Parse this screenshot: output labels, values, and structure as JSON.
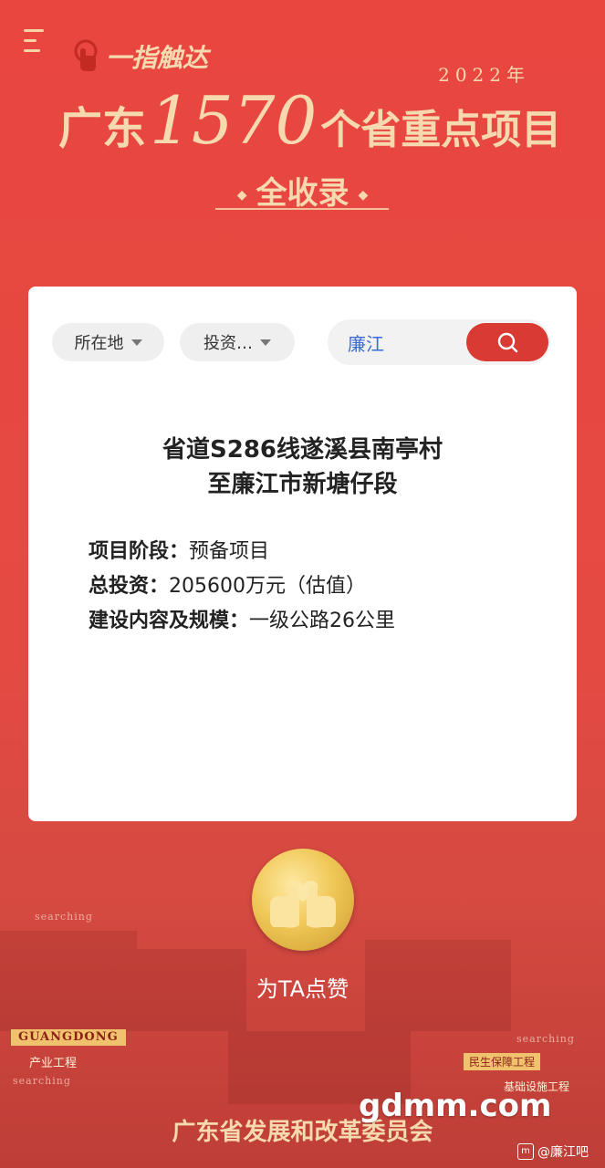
{
  "header": {
    "brand": "一指触达",
    "year": "2022年",
    "title_pre": "广东",
    "title_number": "1570",
    "title_post": "个省重点项目",
    "subtitle": "全收录"
  },
  "filters": {
    "location_label": "所在地",
    "investment_label": "投资…"
  },
  "search": {
    "value": "廉江"
  },
  "project": {
    "title_line1": "省道S286线遂溪县南亭村",
    "title_line2": "至廉江市新塘仔段",
    "stage_label": "项目阶段：",
    "stage_value": "预备项目",
    "investment_label": "总投资：",
    "investment_value": "205600万元（估值）",
    "scope_label": "建设内容及规模：",
    "scope_value": "一级公路26公里"
  },
  "like": {
    "label": "为TA点赞"
  },
  "background": {
    "searching_1": "searching",
    "searching_2": "searching",
    "searching_3": "searching",
    "guangdong": "GUANGDONG",
    "industry": "产业工程",
    "minsheng": "民生保障工程",
    "infrastructure": "基础设施工程"
  },
  "footer": {
    "org": "广东省发展和改革委员会",
    "watermark": "gdmm.com",
    "weibo": "@廉江吧"
  },
  "colors": {
    "background": "#e8463f",
    "accent_gold": "#f7d9b0",
    "search_button": "#d93a33",
    "search_text": "#3b6bd6"
  }
}
